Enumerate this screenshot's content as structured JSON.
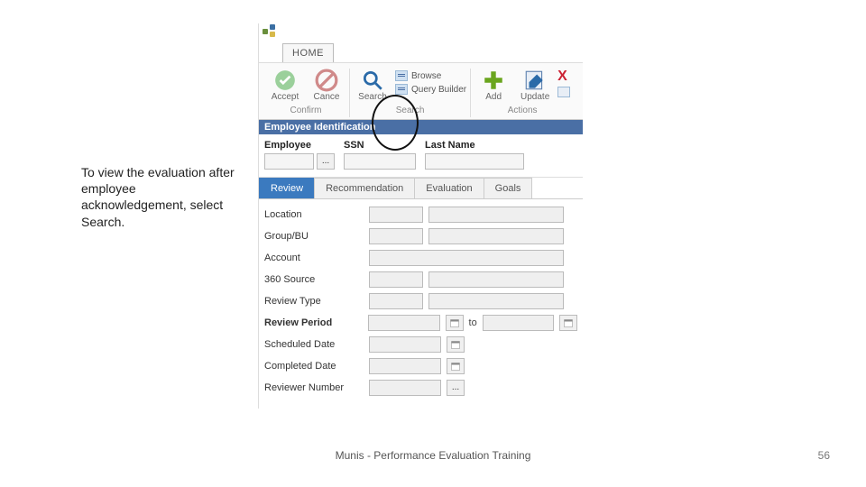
{
  "instruction_text": "To view the evaluation after employee acknowledgement, select Search.",
  "home_tab": "HOME",
  "ribbon": {
    "confirm": {
      "caption": "Confirm",
      "accept": "Accept",
      "cancel": "Cance"
    },
    "search": {
      "caption": "Search",
      "search": "Search",
      "browse": "Browse",
      "query_builder": "Query Builder"
    },
    "actions": {
      "caption": "Actions",
      "add": "Add",
      "update": "Update"
    }
  },
  "section_header": "Employee Identification",
  "emp_fields": {
    "employee": "Employee",
    "ssn": "SSN",
    "last_name": "Last Name"
  },
  "ellipsis": "...",
  "tabs": {
    "review": "Review",
    "recommendation": "Recommendation",
    "evaluation": "Evaluation",
    "goals": "Goals"
  },
  "form": {
    "location": "Location",
    "group_bu": "Group/BU",
    "account": "Account",
    "source_360": "360 Source",
    "review_type": "Review Type",
    "review_period": "Review Period",
    "scheduled_date": "Scheduled Date",
    "completed_date": "Completed Date",
    "reviewer_number": "Reviewer Number",
    "to": "to"
  },
  "footer": {
    "title": "Munis - Performance Evaluation Training",
    "page": "56"
  }
}
